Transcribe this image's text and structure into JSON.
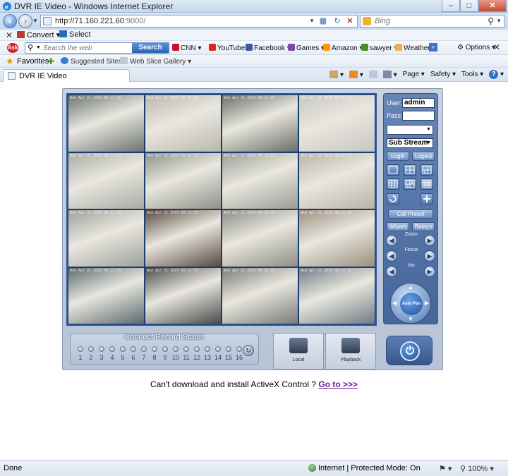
{
  "window": {
    "title": "DVR IE Video - Windows Internet Explorer",
    "minimize": "–",
    "maximize": "□",
    "close": "✕"
  },
  "address": {
    "url_main": "http://71.160.221.60",
    "url_port": ":9000/"
  },
  "search": {
    "placeholder": "Bing",
    "icon": "search-icon"
  },
  "commandbar": {
    "convert": "Convert",
    "select": "Select"
  },
  "ask_toolbar": {
    "logo": "Ask",
    "placeholder": "Search the web",
    "button": "Search",
    "items": [
      {
        "label": "CNN",
        "color": "#c8102e"
      },
      {
        "label": "YouTube",
        "color": "#e62117"
      },
      {
        "label": "Facebook",
        "color": "#3b5998"
      },
      {
        "label": "Games",
        "color": "#7b4aa8"
      },
      {
        "label": "Amazon",
        "color": "#ff9900"
      },
      {
        "label": "sawyer",
        "color": "#4a8f2a"
      },
      {
        "label": "Weather",
        "color": "#f2b134"
      }
    ],
    "options": "Options"
  },
  "favorites": {
    "label": "Favorites",
    "items": [
      "Suggested Sites",
      "Web Slice Gallery"
    ]
  },
  "tab": {
    "title": "DVR IE Video"
  },
  "tabtools": {
    "page": "Page",
    "safety": "Safety",
    "tools": "Tools",
    "help": "?"
  },
  "dvr": {
    "user_label": "User:",
    "user_value": "admin",
    "pass_label": "Pass:",
    "pass_value": "",
    "stream_value": "Sub Stream",
    "channel_value": "",
    "login": "Login",
    "logout": "Logout",
    "call_preset": "Call Preset",
    "wipers": "Wipers",
    "relays": "Relays",
    "zoom": "Zoom",
    "focus": "Focus",
    "iris": "Iris",
    "auto_pan": "Auto Pan",
    "status_title": "Connect Record Status",
    "channels": [
      "1",
      "2",
      "3",
      "4",
      "5",
      "6",
      "7",
      "8",
      "9",
      "10",
      "11",
      "12",
      "13",
      "14",
      "15",
      "16"
    ],
    "local": "Local",
    "playback": "Playback",
    "timestamp": "Wed Apr 21 2010 09:12:33",
    "cameras": [
      {
        "tone": "#6d7570"
      },
      {
        "tone": "#b9b7ad"
      },
      {
        "tone": "#6a6f68"
      },
      {
        "tone": "#c7c6c0"
      },
      {
        "tone": "#a9aba4"
      },
      {
        "tone": "#8f918a"
      },
      {
        "tone": "#9a9d96"
      },
      {
        "tone": "#b8b3a7"
      },
      {
        "tone": "#9da09a"
      },
      {
        "tone": "#59493e"
      },
      {
        "tone": "#8d8e86"
      },
      {
        "tone": "#9c8f7f"
      },
      {
        "tone": "#5c6a6e"
      },
      {
        "tone": "#4a4b4a"
      },
      {
        "tone": "#7a7c77"
      },
      {
        "tone": "#717c86"
      }
    ]
  },
  "activex": {
    "text": "Can't download and install ActiveX Control ? ",
    "link": "Go to >>>"
  },
  "statusbar": {
    "done": "Done",
    "zone": "Internet | Protected Mode: On",
    "zoom": "100%"
  }
}
